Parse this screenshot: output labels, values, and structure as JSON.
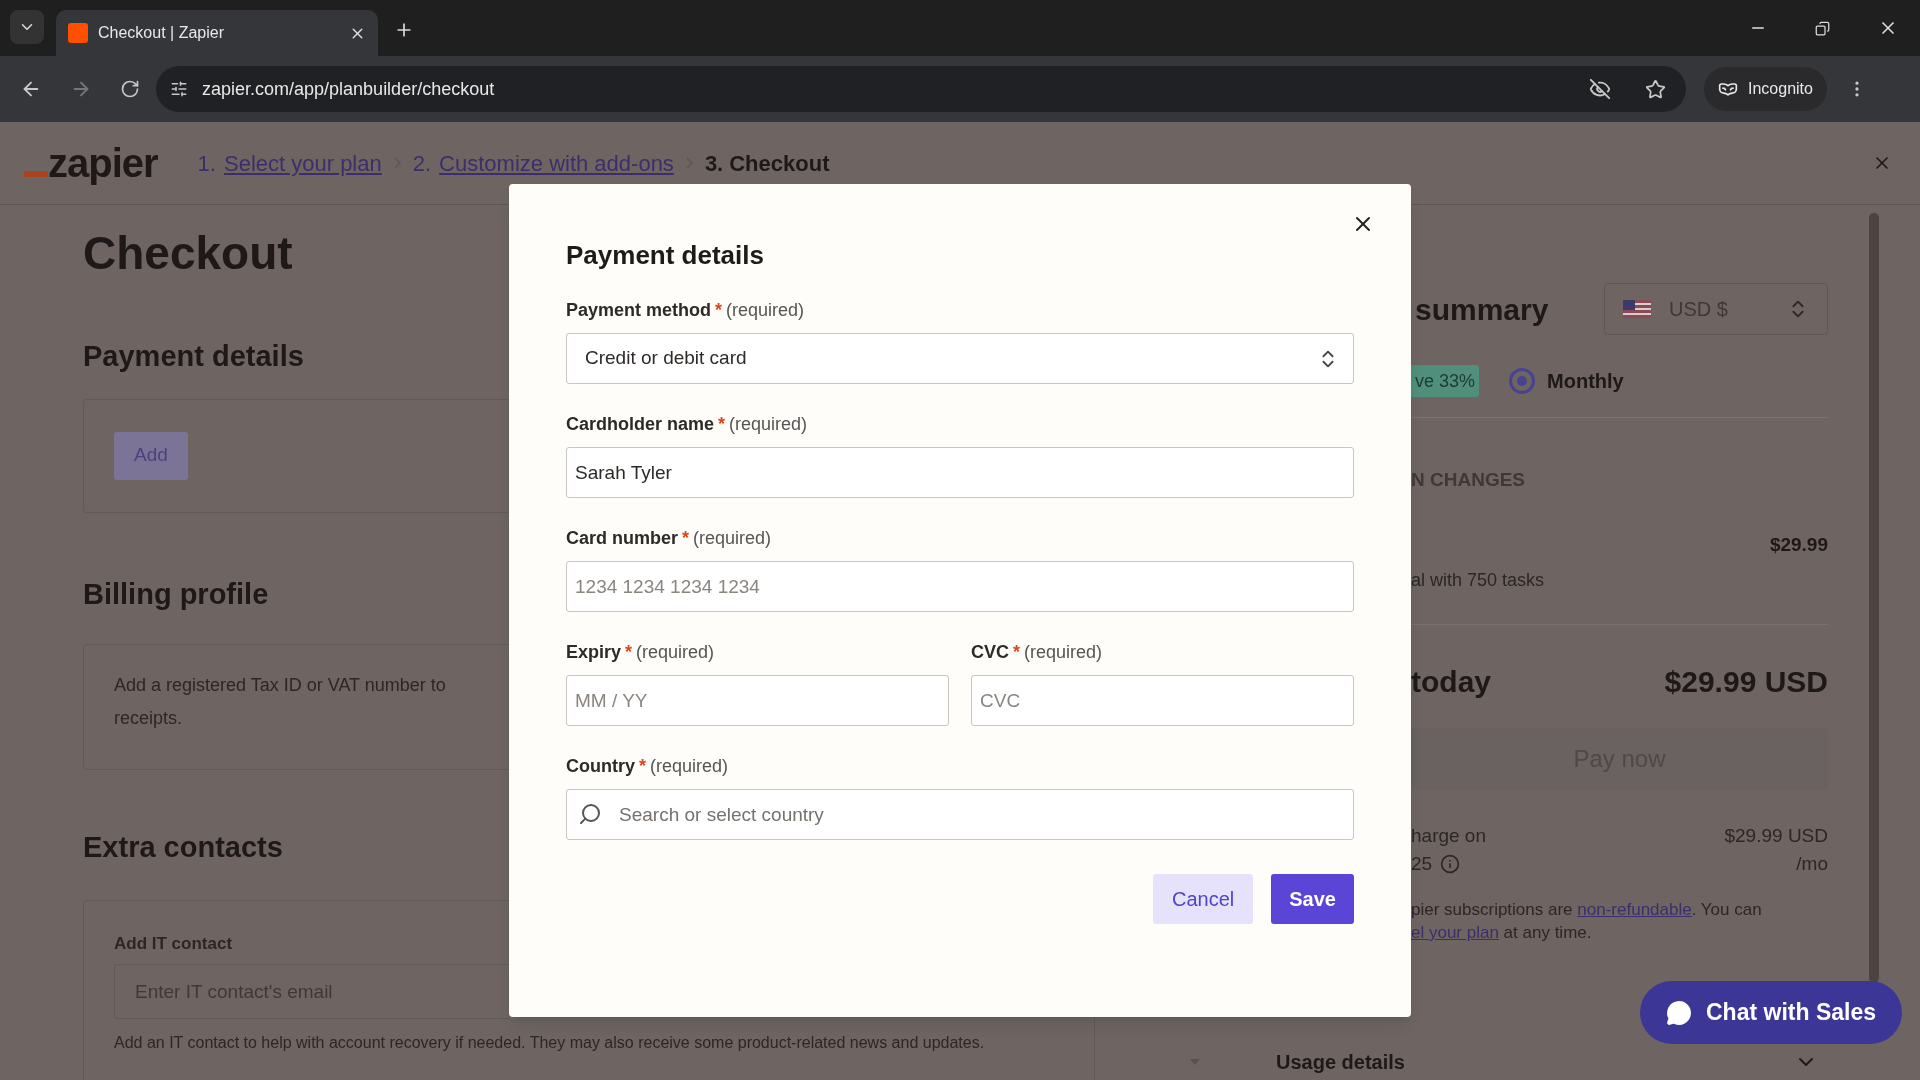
{
  "browser": {
    "tab_title": "Checkout | Zapier",
    "url": "zapier.com/app/planbuilder/checkout",
    "profile": "Incognito"
  },
  "header": {
    "logo": "zapier",
    "steps": [
      {
        "number": "1.",
        "label": "Select your plan",
        "current": false
      },
      {
        "number": "2.",
        "label": "Customize with add-ons",
        "current": false
      },
      {
        "number": "3.",
        "label": "Checkout",
        "current": true
      }
    ]
  },
  "page": {
    "title": "Checkout",
    "payment": {
      "heading": "Payment details",
      "button": "Add"
    },
    "billing": {
      "heading": "Billing profile",
      "text_line1": "Add a registered Tax ID or VAT number to",
      "text_line2": "receipts."
    },
    "contacts": {
      "heading": "Extra contacts",
      "label": "Add IT contact",
      "placeholder": "Enter IT contact's email",
      "help": "Add an IT contact to help with account recovery if needed. They may also receive some product-related news and updates."
    }
  },
  "summary": {
    "title": "summary",
    "currency": "USD $",
    "discount_badge": "ve 33%",
    "billing_options": [
      {
        "label": "Monthly",
        "selected": true
      }
    ],
    "section_label": "N CHANGES",
    "line_price": "$29.99",
    "line_description": "al with 750 tasks",
    "total_label": "today",
    "total_amount": "$29.99 USD",
    "pay_button": {
      "label": "Pay now",
      "disabled": true
    },
    "next_charge": {
      "line1": "harge on",
      "line2": "25",
      "amount": "$29.99 USD",
      "period": "/mo"
    },
    "fine_print": {
      "before": "pier subscriptions are ",
      "link1": "non-refundable",
      "middle": ". You can",
      "link2": "el your plan",
      "after": " at any time."
    },
    "usage": "Usage details"
  },
  "chat_button": "Chat with Sales",
  "modal": {
    "title": "Payment details",
    "rows": [
      {
        "fields": [
          {
            "kind": "select",
            "label": "Payment method",
            "mark": "*",
            "note": "(required)",
            "value": "Credit or debit card"
          }
        ]
      },
      {
        "fields": [
          {
            "kind": "input",
            "label": "Cardholder name",
            "mark": "*",
            "note": "(required)",
            "value": "Sarah Tyler"
          }
        ]
      },
      {
        "fields": [
          {
            "kind": "input",
            "label": "Card number",
            "mark": "*",
            "note": "(required)",
            "placeholder": "1234 1234 1234 1234"
          }
        ]
      },
      {
        "fields": [
          {
            "kind": "input",
            "label": "Expiry",
            "mark": "*",
            "note": "(required)",
            "placeholder": "MM / YY"
          },
          {
            "kind": "input",
            "label": "CVC",
            "mark": "*",
            "note": "(required)",
            "placeholder": "CVC"
          }
        ]
      },
      {
        "fields": [
          {
            "kind": "search",
            "label": "Country",
            "mark": "*",
            "note": "(required)",
            "placeholder": "Search or select country"
          }
        ]
      }
    ],
    "cancel": "Cancel",
    "save": "Save"
  }
}
